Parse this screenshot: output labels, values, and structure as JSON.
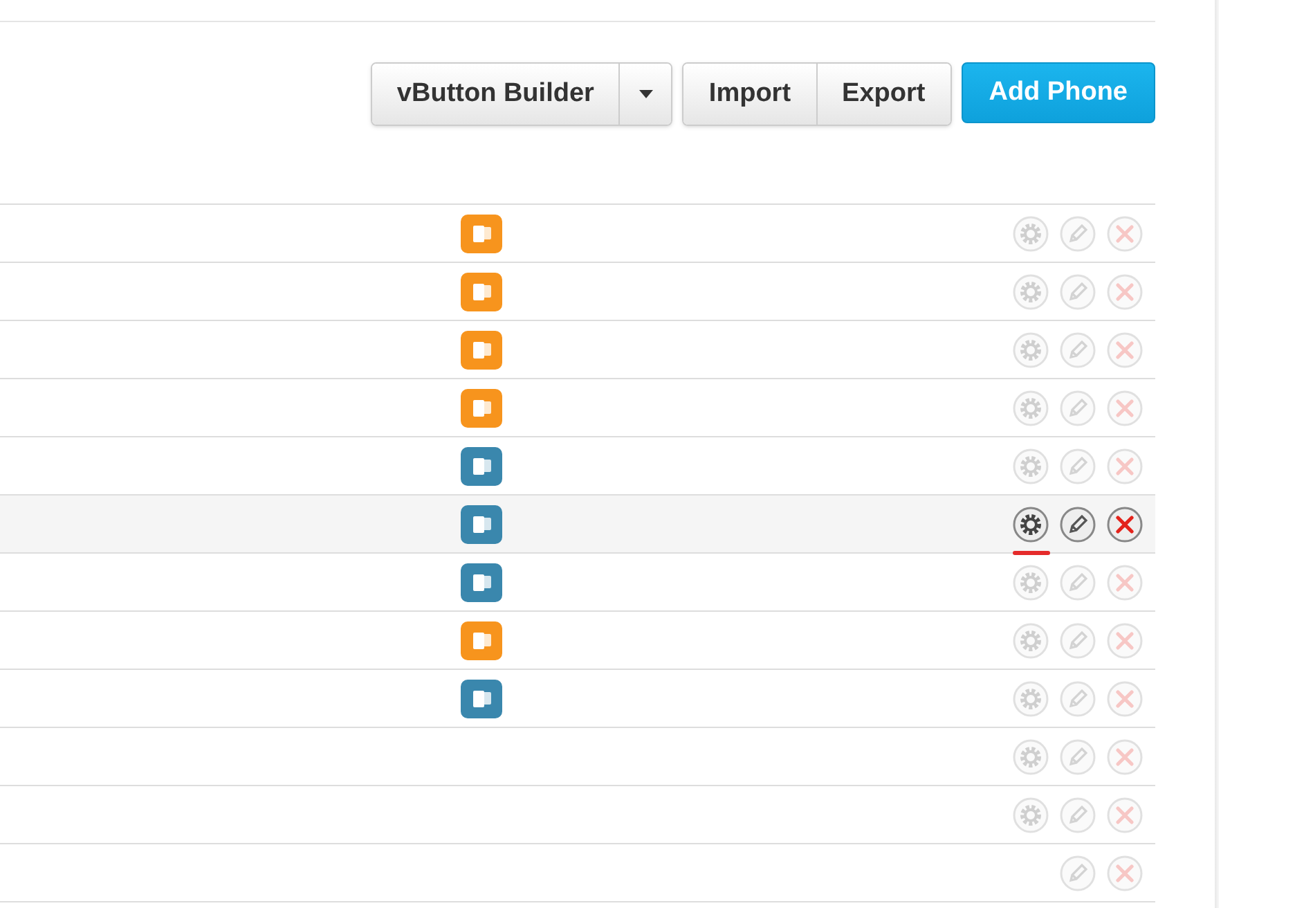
{
  "toolbar": {
    "builder_button": "vButton Builder",
    "import_button": "Import",
    "export_button": "Export",
    "add_button": "Add Phone"
  },
  "rows": [
    {
      "color": "#f7941d",
      "highlighted": false,
      "has_settings": true
    },
    {
      "color": "#f7941d",
      "highlighted": false,
      "has_settings": true
    },
    {
      "color": "#f7941d",
      "highlighted": false,
      "has_settings": true
    },
    {
      "color": "#f7941d",
      "highlighted": false,
      "has_settings": true
    },
    {
      "color": "#3a87ad",
      "highlighted": false,
      "has_settings": true
    },
    {
      "color": "#3a87ad",
      "highlighted": true,
      "has_settings": true
    },
    {
      "color": "#3a87ad",
      "highlighted": false,
      "has_settings": true
    },
    {
      "color": "#f7941d",
      "highlighted": false,
      "has_settings": true
    },
    {
      "color": "#3a87ad",
      "highlighted": false,
      "has_settings": true
    },
    {
      "highlighted": false,
      "has_settings": true
    },
    {
      "highlighted": false,
      "has_settings": true
    },
    {
      "highlighted": false,
      "has_settings": false
    }
  ]
}
